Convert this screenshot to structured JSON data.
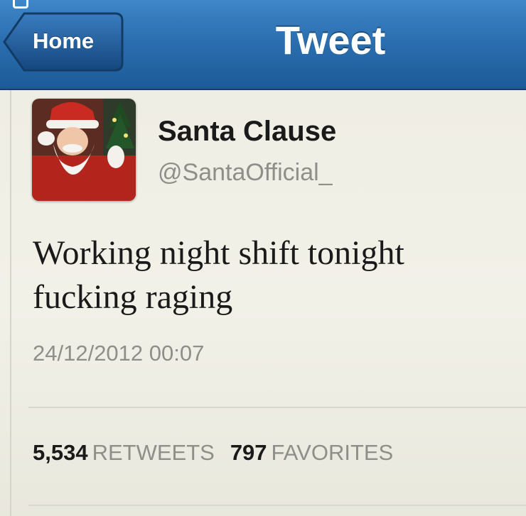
{
  "navbar": {
    "back_label": "Home",
    "title": "Tweet"
  },
  "tweet": {
    "display_name": "Santa Clause",
    "handle": "@SantaOfficial_",
    "text_lines": [
      "Working night shift tonight",
      "fucking raging"
    ],
    "timestamp": "24/12/2012 00:07"
  },
  "stats": {
    "retweets_count": "5,534",
    "retweets_label": "RETWEETS",
    "favorites_count": "797",
    "favorites_label": "FAVORITES"
  },
  "colors": {
    "nav_blue": "#2b6fb0",
    "background": "#efeee4",
    "secondary_text": "#8e8e8a"
  },
  "icons": {
    "back": "back-arrow-button",
    "avatar": "santa-avatar"
  }
}
